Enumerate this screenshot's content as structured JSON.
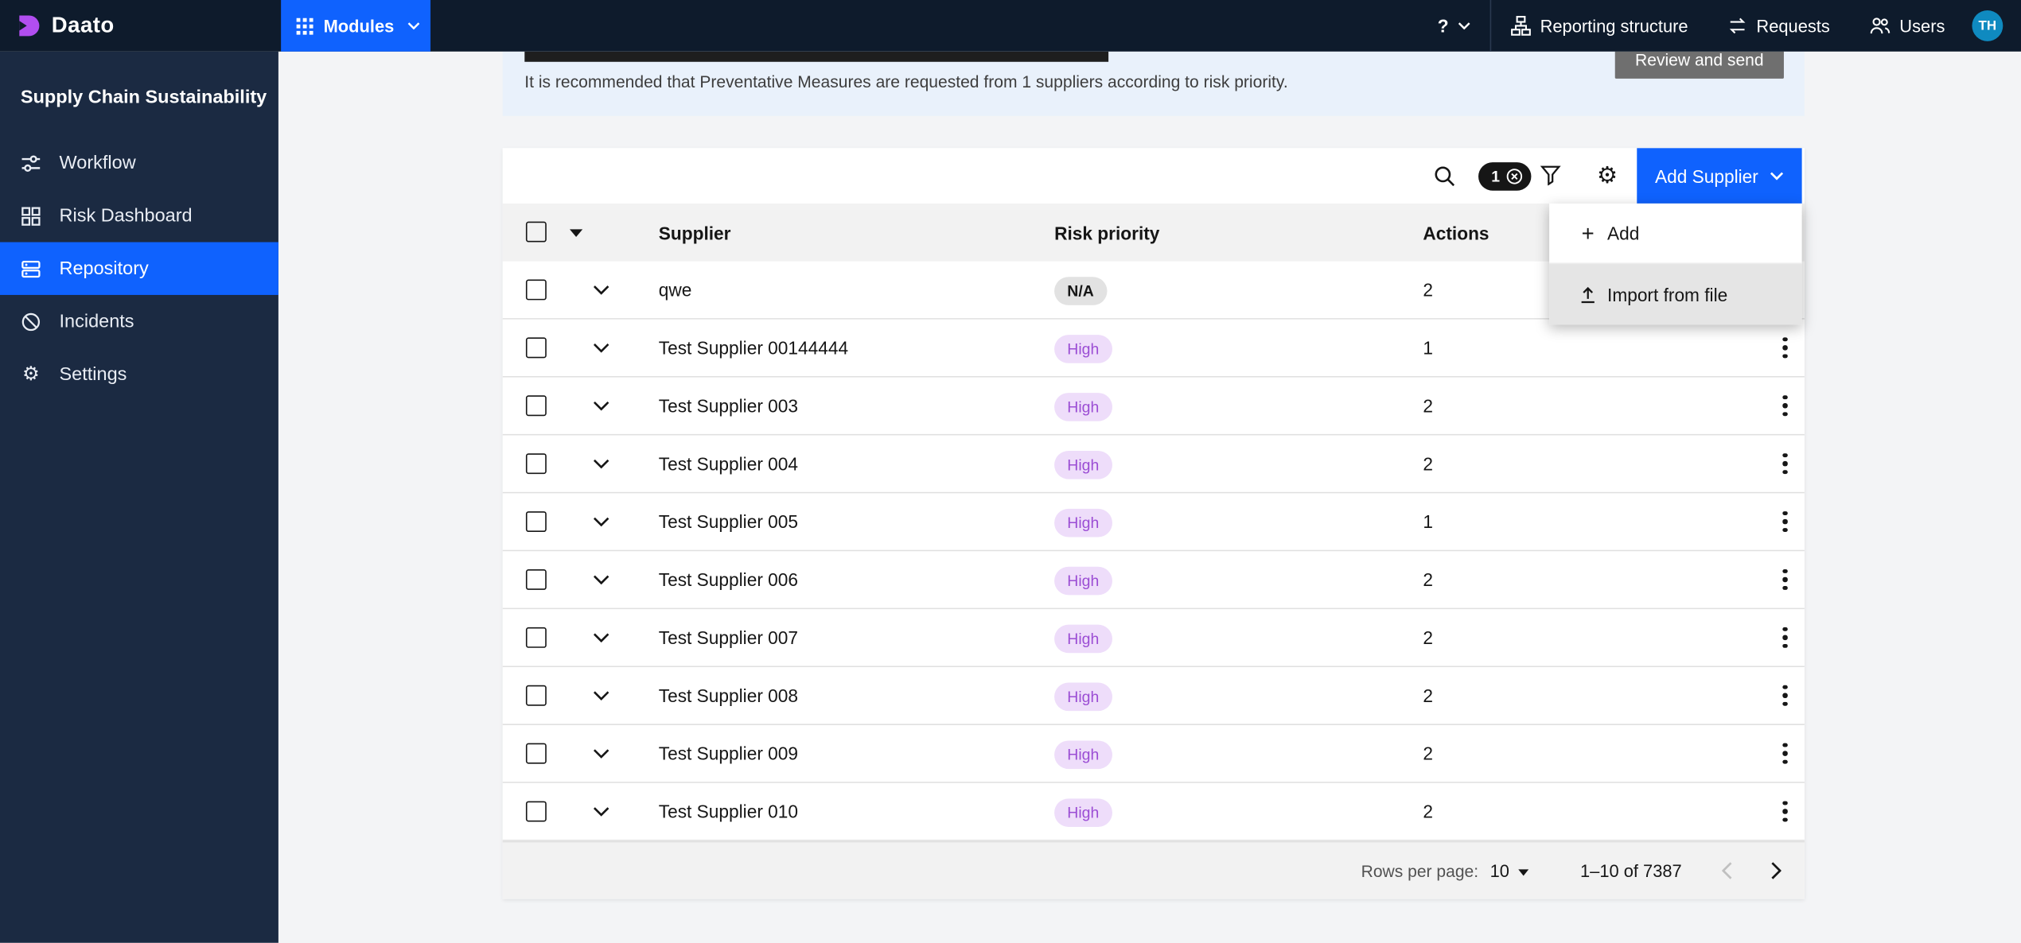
{
  "topbar": {
    "brand": "Daato",
    "modules": {
      "label": "Modules"
    },
    "help_label": "?",
    "nav": [
      {
        "label": "Reporting structure",
        "icon": "reporting-structure-icon"
      },
      {
        "label": "Requests",
        "icon": "requests-icon"
      },
      {
        "label": "Users",
        "icon": "users-icon"
      }
    ],
    "avatar_initials": "TH"
  },
  "sidebar": {
    "title": "Supply Chain Sustainability",
    "items": [
      {
        "label": "Workflow",
        "icon": "workflow-icon",
        "active": false
      },
      {
        "label": "Risk Dashboard",
        "icon": "dashboard-icon",
        "active": false
      },
      {
        "label": "Repository",
        "icon": "repository-icon",
        "active": true
      },
      {
        "label": "Incidents",
        "icon": "incidents-icon",
        "active": false
      },
      {
        "label": "Settings",
        "icon": "settings-icon",
        "active": false
      }
    ]
  },
  "banner": {
    "message": "It is recommended that Preventative Measures are requested from 1 suppliers according to risk priority.",
    "review_button_label": "Review and send"
  },
  "toolbar": {
    "filter_count": "1",
    "add_supplier_label": "Add Supplier",
    "icons": [
      "search-icon",
      "clear-filter-icon",
      "filter-funnel-icon",
      "gear-icon"
    ]
  },
  "add_menu": {
    "items": [
      {
        "label": "Add",
        "icon": "plus-icon",
        "highlighted": false
      },
      {
        "label": "Import from file",
        "icon": "upload-icon",
        "highlighted": true
      }
    ]
  },
  "table": {
    "columns": [
      "Supplier",
      "Risk priority",
      "Actions"
    ],
    "rows": [
      {
        "supplier": "qwe",
        "risk": "N/A",
        "risk_type": "na",
        "actions": "2"
      },
      {
        "supplier": "Test Supplier 00144444",
        "risk": "High",
        "risk_type": "high",
        "actions": "1"
      },
      {
        "supplier": "Test Supplier 003",
        "risk": "High",
        "risk_type": "high",
        "actions": "2"
      },
      {
        "supplier": "Test Supplier 004",
        "risk": "High",
        "risk_type": "high",
        "actions": "2"
      },
      {
        "supplier": "Test Supplier 005",
        "risk": "High",
        "risk_type": "high",
        "actions": "1"
      },
      {
        "supplier": "Test Supplier 006",
        "risk": "High",
        "risk_type": "high",
        "actions": "2"
      },
      {
        "supplier": "Test Supplier 007",
        "risk": "High",
        "risk_type": "high",
        "actions": "2"
      },
      {
        "supplier": "Test Supplier 008",
        "risk": "High",
        "risk_type": "high",
        "actions": "2"
      },
      {
        "supplier": "Test Supplier 009",
        "risk": "High",
        "risk_type": "high",
        "actions": "2"
      },
      {
        "supplier": "Test Supplier 010",
        "risk": "High",
        "risk_type": "high",
        "actions": "2"
      }
    ]
  },
  "pagination": {
    "rows_per_page_label": "Rows per page:",
    "rows_per_page_value": "10",
    "range_text": "1–10 of 7387"
  },
  "colors": {
    "accent_blue": "#0f62fe",
    "topbar_bg": "#0e1b2c",
    "sidebar_bg": "#1b2a42",
    "banner_bg": "#e9f1fb",
    "review_button_bg": "#6f6f6f",
    "tag_high_bg": "#eeddfa",
    "tag_high_text": "#9b4dd4",
    "tag_na_bg": "#e2e2e2",
    "tag_na_text": "#161616",
    "avatar_bg": "#0f8ac0"
  }
}
